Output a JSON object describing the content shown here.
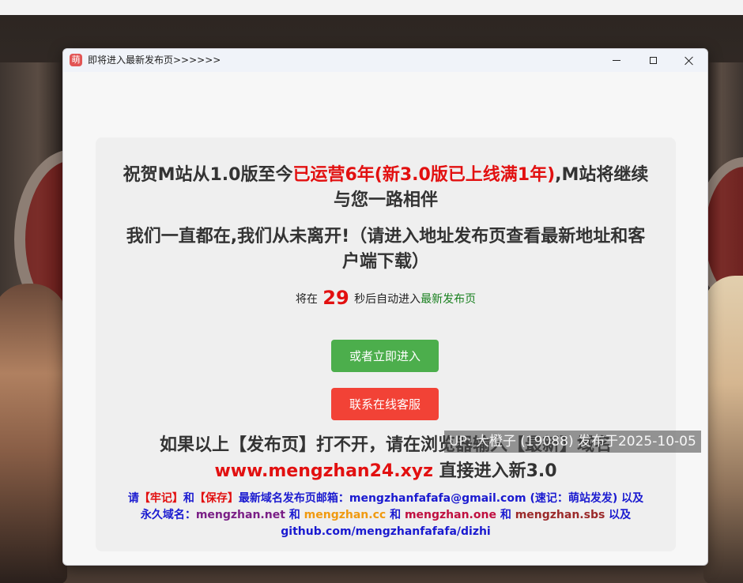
{
  "window": {
    "title": "即将进入最新发布页>>>>>>",
    "app_icon_glyph": "萌"
  },
  "content": {
    "line1_part1": "祝贺M站从1.0版至今",
    "line1_highlight": "已运营6年(新3.0版已上线满1年)",
    "line1_part2": ",M站将继续与您一路相伴",
    "line2": "我们一直都在,我们从未离开!（请进入地址发布页查看最新地址和客户端下载）",
    "countdown_prefix": "将在",
    "countdown_seconds": "29",
    "countdown_middle": "秒后自动进入",
    "countdown_link": "最新发布页",
    "enter_button": "或者立即进入",
    "service_button": "联系在线客服",
    "fallback_line1": "如果以上【发布页】打不开，请在浏览器输入【最新】域名",
    "fallback_domain": "www.mengzhan24.xyz",
    "fallback_suffix": "直接进入新3.0",
    "note_please": "请",
    "note_remember": "【牢记】",
    "note_and1": "和",
    "note_save": "【保存】",
    "note_mail_text": "最新域名发布页邮箱：mengzhanfafafa@gmail.com (速记：萌站发发) 以及永久域名：",
    "domain_net": "mengzhan.net",
    "note_and2": "和",
    "domain_cc": "mengzhan.cc",
    "note_and3": "和",
    "domain_one": "mengzhan.one",
    "note_and4": "和",
    "domain_sbs": "mengzhan.sbs",
    "note_github": "以及 github.com/mengzhanfafafa/dizhi"
  },
  "watermark": "UP: 大橙子 (19088) 发布于2025-10-05",
  "colors": {
    "highlight_red": "#e21010",
    "enter_green": "#4cae4c",
    "service_red": "#f24236",
    "note_blue": "#1a1ad0"
  }
}
